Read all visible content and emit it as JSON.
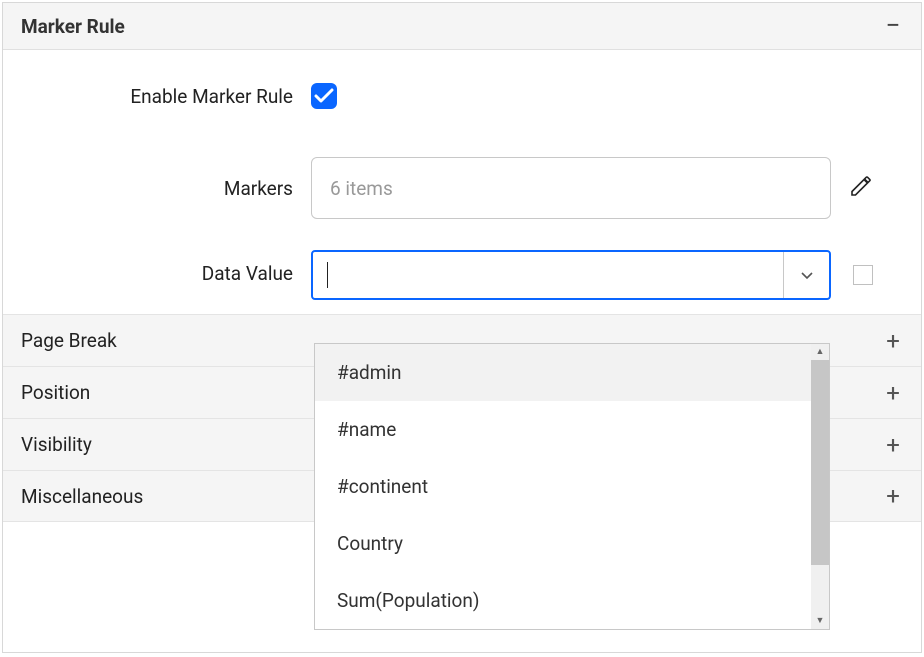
{
  "panel": {
    "title": "Marker Rule"
  },
  "form": {
    "enable_label": "Enable Marker Rule",
    "enable_checked": true,
    "markers_label": "Markers",
    "markers_placeholder": "6 items",
    "datavalue_label": "Data Value",
    "datavalue_value": ""
  },
  "dropdown": {
    "options": [
      "#admin",
      "#name",
      "#continent",
      "Country",
      "Sum(Population)"
    ]
  },
  "sections": {
    "items": [
      "Page Break",
      "Position",
      "Visibility",
      "Miscellaneous"
    ]
  }
}
